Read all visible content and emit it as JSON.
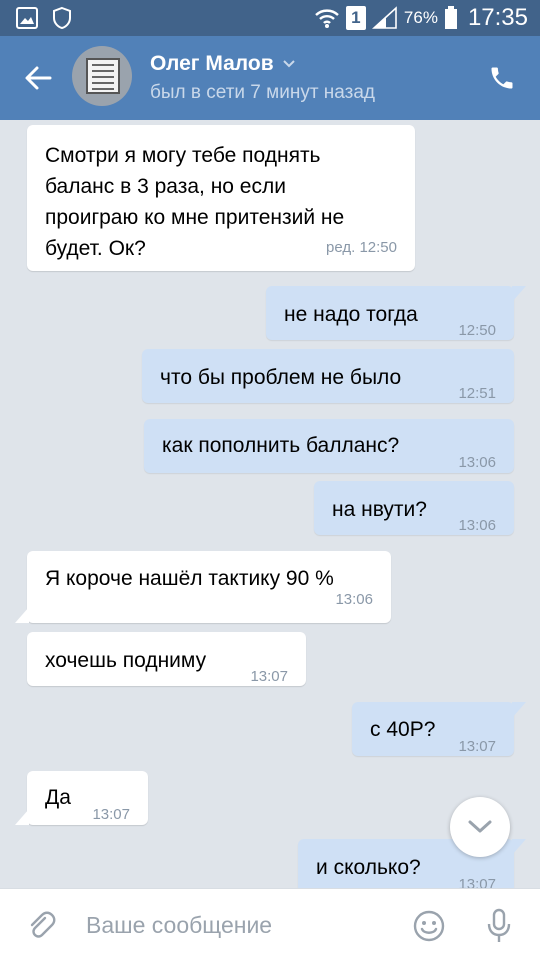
{
  "status_bar": {
    "battery": "76%",
    "time": "17:35",
    "sim": "1"
  },
  "header": {
    "name": "Олег Малов",
    "status": "был в сети 7 минут назад"
  },
  "messages": [
    {
      "dir": "in",
      "lines": [
        "Смотри я могу тебе поднять",
        "баланс в 3 раза, но если",
        "проиграю ко мне притензий не",
        "будет. Ок?"
      ],
      "time": "ред. 12:50"
    },
    {
      "dir": "out",
      "text": "не надо тогда",
      "time": "12:50"
    },
    {
      "dir": "out",
      "text": "что бы проблем не было",
      "time": "12:51"
    },
    {
      "dir": "out",
      "text": "как пополнить балланс?",
      "time": "13:06"
    },
    {
      "dir": "out",
      "text": "на нвути?",
      "time": "13:06"
    },
    {
      "dir": "in",
      "text": "Я короче нашёл тактику 90 %",
      "time": "13:06"
    },
    {
      "dir": "in",
      "text": "хочешь подниму",
      "time": "13:07"
    },
    {
      "dir": "out",
      "text": "с 40Р?",
      "time": "13:07"
    },
    {
      "dir": "in",
      "text": "Да",
      "time": "13:07"
    },
    {
      "dir": "out",
      "text": "и сколько?",
      "time": "13:07"
    }
  ],
  "input": {
    "placeholder": "Ваше сообщение"
  },
  "colors": {
    "header": "#5181b8",
    "status_bar": "#41638a",
    "chat_bg": "#dfe4ea",
    "outgoing_bubble": "#cfe0f5",
    "incoming_bubble": "#ffffff"
  }
}
